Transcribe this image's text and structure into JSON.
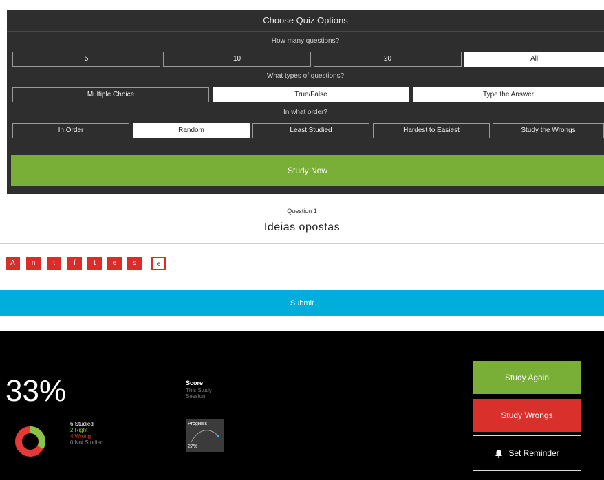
{
  "quiz_options": {
    "title": "Choose Quiz Options",
    "count_heading": "How many questions?",
    "count_options": [
      "5",
      "10",
      "20",
      "All"
    ],
    "count_selected": "All",
    "type_heading": "What types of questions?",
    "type_options": [
      "Multiple Choice",
      "True/False",
      "Type the Answer"
    ],
    "order_heading": "In what order?",
    "order_options": [
      "In Order",
      "Random",
      "Least Studied",
      "Hardest to Easiest",
      "Study the Wrongs"
    ],
    "order_selected": "Random",
    "study_now_label": "Study Now"
  },
  "question": {
    "number_label": "Question 1",
    "prompt": "Ideias opostas",
    "answer_letters": [
      "A",
      "n",
      "t",
      "í",
      "t",
      "e",
      "s",
      "e"
    ],
    "submit_label": "Submit"
  },
  "results": {
    "percent": "33%",
    "studied": "6 Studied",
    "right": "2 Right",
    "wrong": "4 Wrong",
    "not_studied": "0 Not Studied",
    "score_title": "Score",
    "score_subtitle": "This Study Session",
    "progress_label": "Progress",
    "progress_value": "27%",
    "study_again_label": "Study Again",
    "study_wrongs_label": "Study Wrongs",
    "set_reminder_label": "Set Reminder",
    "colors": {
      "right": "#8bc34a",
      "wrong": "#e53935",
      "not_studied": "#888888",
      "accent_green": "#7aaf37",
      "accent_red": "#d9302c",
      "submit_blue": "#00aedc"
    },
    "right_count": 2,
    "wrong_count": 4
  }
}
